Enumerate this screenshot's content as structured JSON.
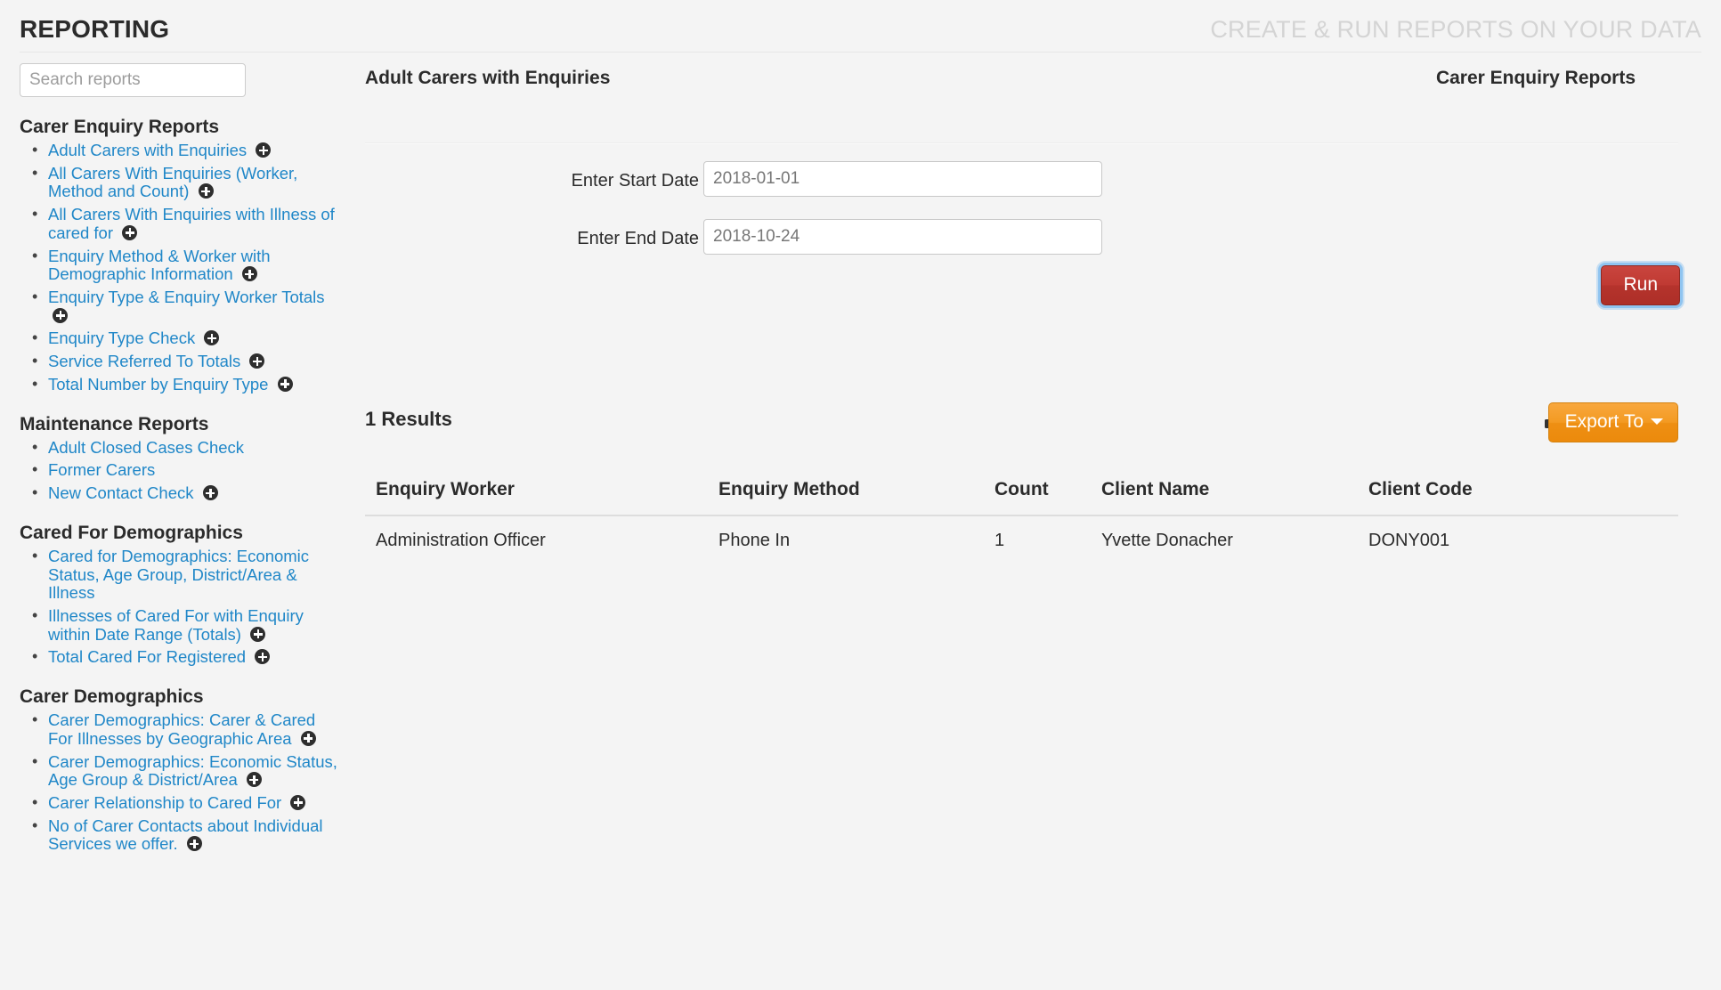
{
  "header": {
    "title": "REPORTING",
    "tagline": "CREATE & RUN REPORTS ON YOUR DATA"
  },
  "sidebar": {
    "search": {
      "placeholder": "Search reports",
      "value": ""
    },
    "groups": [
      {
        "title": "Carer Enquiry Reports",
        "items": [
          {
            "label": "Adult Carers with Enquiries",
            "has_add": true
          },
          {
            "label": "All Carers With Enquiries (Worker, Method and Count)",
            "has_add": true
          },
          {
            "label": "All Carers With Enquiries with Illness of cared for",
            "has_add": true
          },
          {
            "label": "Enquiry Method & Worker with Demographic Information",
            "has_add": true
          },
          {
            "label": "Enquiry Type & Enquiry Worker Totals",
            "has_add": true
          },
          {
            "label": "Enquiry Type Check",
            "has_add": true
          },
          {
            "label": "Service Referred To Totals",
            "has_add": true
          },
          {
            "label": "Total Number by Enquiry Type",
            "has_add": true
          }
        ]
      },
      {
        "title": "Maintenance Reports",
        "items": [
          {
            "label": "Adult Closed Cases Check",
            "has_add": false
          },
          {
            "label": "Former Carers",
            "has_add": false
          },
          {
            "label": "New Contact Check",
            "has_add": true
          }
        ]
      },
      {
        "title": "Cared For Demographics",
        "items": [
          {
            "label": "Cared for Demographics: Economic Status, Age Group, District/Area & Illness",
            "has_add": false
          },
          {
            "label": "Illnesses of Cared For with Enquiry within Date Range (Totals)",
            "has_add": true
          },
          {
            "label": "Total Cared For Registered",
            "has_add": true
          }
        ]
      },
      {
        "title": "Carer Demographics",
        "items": [
          {
            "label": "Carer Demographics: Carer & Cared For Illnesses by Geographic Area",
            "has_add": true
          },
          {
            "label": "Carer Demographics: Economic Status, Age Group & District/Area",
            "has_add": true
          },
          {
            "label": "Carer Relationship to Cared For",
            "has_add": true
          },
          {
            "label": "No of Carer Contacts about Individual Services we offer.",
            "has_add": true
          }
        ]
      }
    ]
  },
  "main": {
    "title": "Adult Carers with Enquiries",
    "subtitle": "Carer Enquiry Reports",
    "form": {
      "start_date": {
        "label": "Enter Start Date",
        "value": "2018-01-01"
      },
      "end_date": {
        "label": "Enter End Date",
        "value": "2018-10-24"
      }
    },
    "run_label": "Run",
    "results_count": "1 Results",
    "export_label": "Export To",
    "print_icon": "printer-icon",
    "table": {
      "columns": [
        "Enquiry Worker",
        "Enquiry Method",
        "Count",
        "Client Name",
        "Client Code"
      ],
      "rows": [
        [
          "Administration Officer",
          "Phone In",
          "1",
          "Yvette Donacher",
          "DONY001"
        ]
      ]
    }
  },
  "colors": {
    "page_bg": "#f4f4f4",
    "link": "#2087c8",
    "run_button": "#bb342d",
    "export_button": "#f19a23",
    "focus_ring": "#8fc4f0",
    "tagline": "#d4d4d4"
  }
}
